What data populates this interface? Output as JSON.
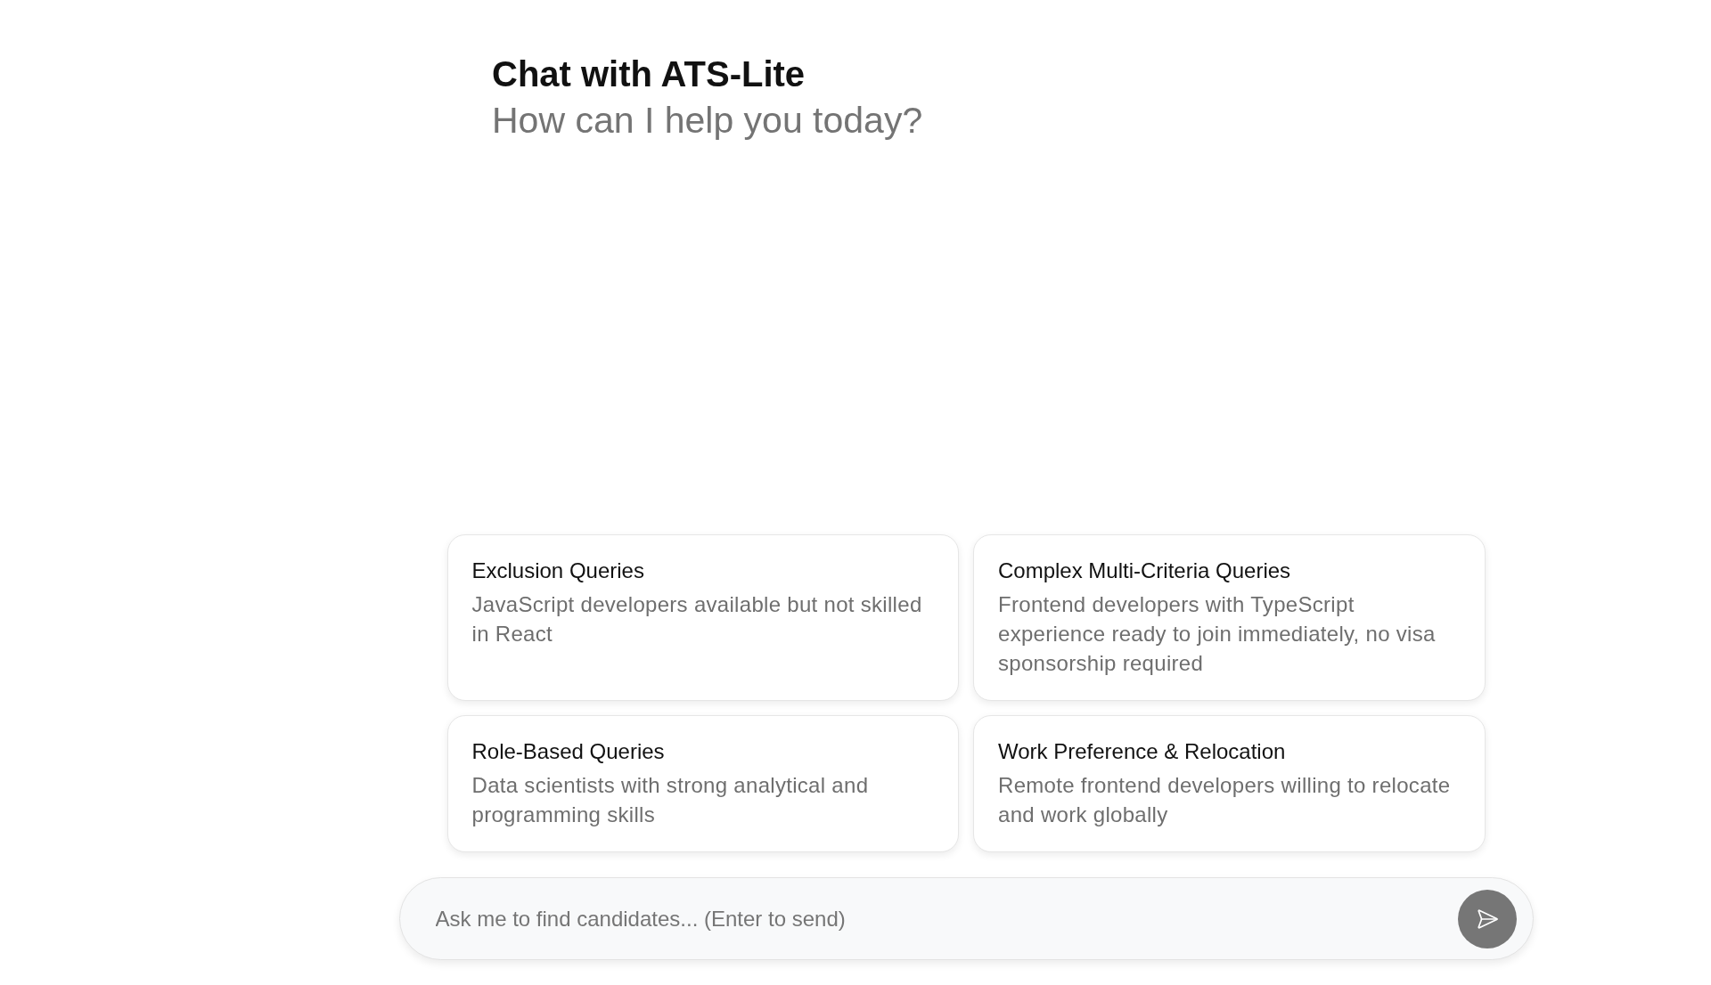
{
  "header": {
    "title": "Chat with ATS-Lite",
    "subtitle": "How can I help you today?"
  },
  "suggestions": [
    {
      "title": "Exclusion Queries",
      "description": "JavaScript developers available but not skilled in React"
    },
    {
      "title": "Complex Multi-Criteria Queries",
      "description": "Frontend developers with TypeScript experience ready to join immediately, no visa sponsorship required"
    },
    {
      "title": "Role-Based Queries",
      "description": "Data scientists with strong analytical and programming skills"
    },
    {
      "title": "Work Preference & Relocation",
      "description": "Remote frontend developers willing to relocate and work globally"
    }
  ],
  "composer": {
    "placeholder": "Ask me to find candidates... (Enter to send)"
  }
}
